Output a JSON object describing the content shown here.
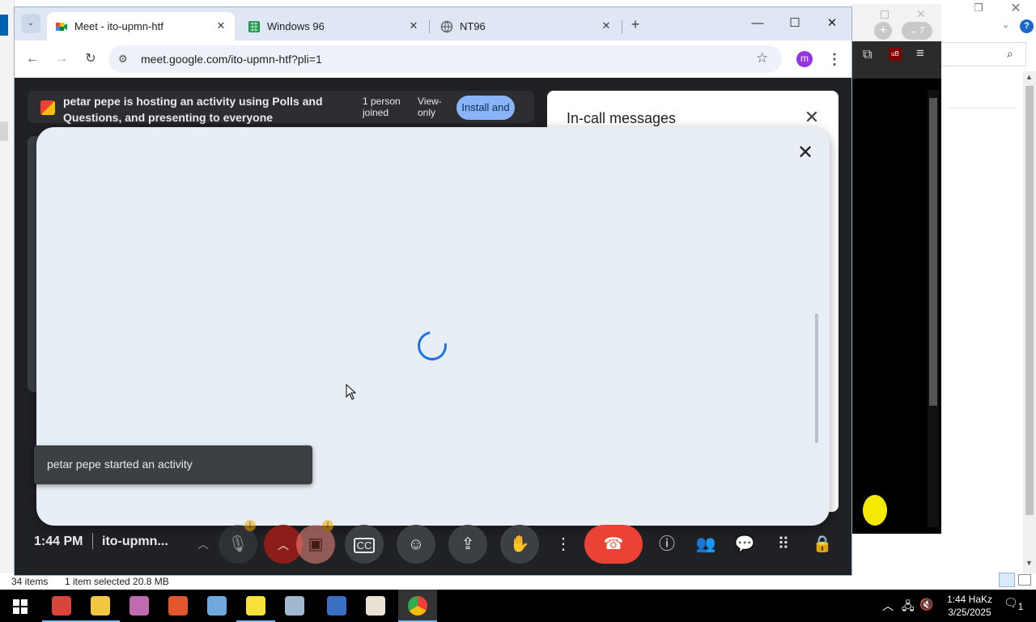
{
  "explorer": {
    "status_items": "34 items",
    "status_selected": "1 item selected  20.8 MB",
    "help_label": "?"
  },
  "bg_chrome": {
    "tab_count": "7"
  },
  "browser": {
    "tabs": [
      {
        "title": "Meet - ito-upmn-htf",
        "active": true,
        "icon": "google-meet-icon"
      },
      {
        "title": "Windows 96",
        "active": false,
        "icon": "windows96-icon"
      },
      {
        "title": "NT96",
        "active": false,
        "icon": "globe-icon"
      }
    ],
    "url": "meet.google.com/ito-upmn-htf?pli=1",
    "profile_initial": "m"
  },
  "meet": {
    "activity_text": "petar pepe is hosting an activity using Polls and Questions, and presenting to everyone",
    "joined_text": "1 person joined",
    "view_text": "View-only",
    "install_label": "Install and",
    "side_panel_title": "In-call messages",
    "toast_text": "petar pepe started an activity",
    "clock": "1:44 PM",
    "meeting_code": "ito-upmn...",
    "warn_badge": "!"
  },
  "taskbar": {
    "time": "1:44 HaKz",
    "date": "3/25/2025",
    "notification_count": "1"
  },
  "colors": {
    "meet_bg": "#202124",
    "dialog_bg": "#e8eef6",
    "hangup_red": "#ea4335",
    "spinner_blue": "#1a73e8"
  }
}
